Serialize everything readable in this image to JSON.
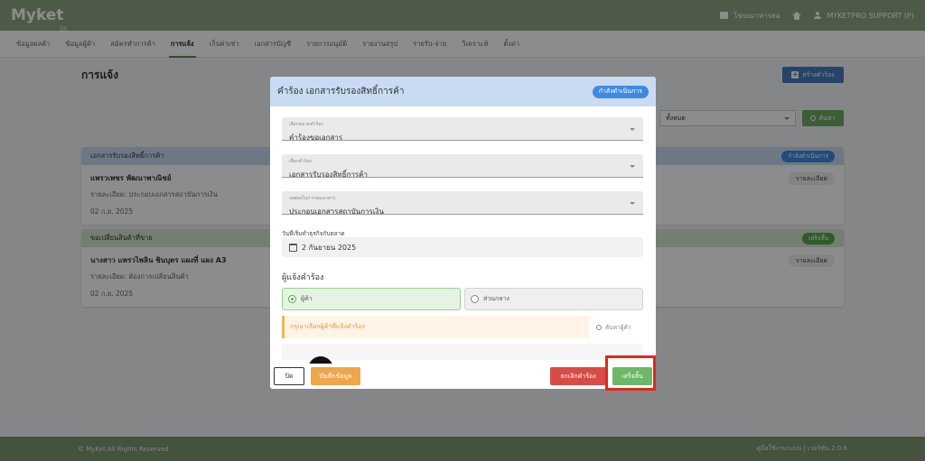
{
  "header": {
    "logo": "Myket",
    "logo_sub": "OS",
    "right_items": [
      {
        "label": "โฆษณาหารสอ"
      },
      {
        "label": "MYKETPRO SUPPORT (P)"
      }
    ]
  },
  "nav": {
    "tabs": [
      {
        "label": "ข้อมูลผลค้า",
        "active": false
      },
      {
        "label": "ข้อมูลผู้ค้า",
        "active": false
      },
      {
        "label": "สมัครทำการค้า",
        "active": false
      },
      {
        "label": "การแจ้ง",
        "active": true
      },
      {
        "label": "เก็บค่าเช่า",
        "active": false
      },
      {
        "label": "เอกสารบัญชี",
        "active": false
      },
      {
        "label": "รายการอนุมัติ",
        "active": false
      },
      {
        "label": "รายงานสรุป",
        "active": false
      },
      {
        "label": "รายรับ-จ่าย",
        "active": false
      },
      {
        "label": "วิเคราะห์",
        "active": false
      },
      {
        "label": "ตั้งค่า",
        "active": false
      }
    ]
  },
  "page": {
    "title": "การแจ้ง",
    "create_button": "สร้างคำร้อง",
    "filter_value": "ทั้งหมด",
    "search_button": "ค้นหา"
  },
  "cards": [
    {
      "head": "เอกสารรับรองสิทธิ์การค้า",
      "status": "กำลังดำเนินการ",
      "status_color": "#3f8ae0",
      "head_bg": "#c8dbf2",
      "name": "แพรวเพชร พัฒนาพาณิชย์",
      "desc": "รายละเอียด: ประกอบเอกสารสถาบันการเงิน",
      "date": "02 ก.ย. 2025",
      "detail": "รายละเอียด"
    },
    {
      "head": "ขอเปลี่ยนสินค้าที่ขาย",
      "status": "เสร็จสิ้น",
      "status_color": "#5aa552",
      "head_bg": "#d4e8cf",
      "name": "นางสาว แพรวไพลิน ชินบุตร แผงที่ แผง A3",
      "desc": "รายละเอียด: ต้องการเปลี่ยนสินค้า",
      "date": "02 ก.ย. 2025",
      "detail": "รายละเอียด"
    }
  ],
  "footer": {
    "left": "© MyKet All Rights Reserved",
    "right": "คู่มือใช้งานระบบ | เวอร์ชัน 2.0.6"
  },
  "modal": {
    "title": "คำร้อง เอกสารรับรองสิทธิ์การค้า",
    "status": "กำลังดำเนินการ",
    "fields": [
      {
        "label": "เลือกหมวดคำร้อง",
        "value": "คำร้องขอเอกสาร"
      },
      {
        "label": "เลือกคำร้อง",
        "value": "เอกสารรับรองสิทธิ์การค้า"
      },
      {
        "label": "เหตุผลในการขอเอกสาร",
        "value": "ประกอบเอกสารสถาบันการเงิน"
      }
    ],
    "date_label": "วันที่เริ่มทำธุรกิจกับตลาด",
    "date_value": "2 กันยายน 2025",
    "section_title": "ผู้แจ้งคำร้อง",
    "radio_options": [
      {
        "label": "ผู้ค้า",
        "checked": true
      },
      {
        "label": "ส่วนกลาง",
        "checked": false
      }
    ],
    "warning": "กรุณาเลือกผู้ค้าที่แจ้งคำร้อง",
    "search_user": "ค้นหาผู้ค้า",
    "buttons": {
      "close": "ปิด",
      "save": "บันทึกข้อมูล",
      "cancel": "ยกเลิกคำร้อง",
      "done": "เสร็จสิ้น"
    }
  }
}
